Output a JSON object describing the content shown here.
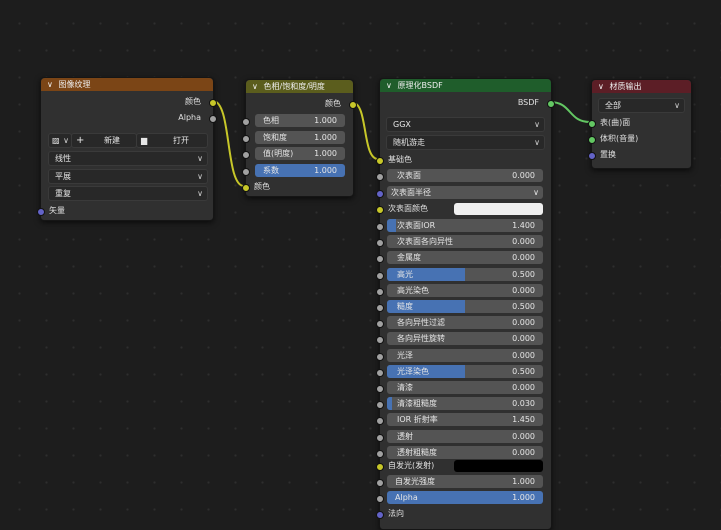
{
  "image_texture": {
    "title": "图像纹理",
    "outputs": [
      "颜色",
      "Alpha"
    ],
    "new_label": "新建",
    "open_label": "打开",
    "dropdowns": [
      "线性",
      "平展",
      "重复"
    ],
    "input_vector": "矢量"
  },
  "hsv": {
    "title": "色相/饱和度/明度",
    "output": "颜色",
    "fields": [
      {
        "label": "色相",
        "value": "1.000"
      },
      {
        "label": "饱和度",
        "value": "1.000"
      },
      {
        "label": "值(明度)",
        "value": "1.000"
      },
      {
        "label": "系数",
        "value": "1.000"
      }
    ],
    "input_color": "颜色"
  },
  "bsdf": {
    "title": "原理化BSDF",
    "output": "BSDF",
    "distribution": "GGX",
    "subsurface_method": "随机游走",
    "base_color": "基础色",
    "subsurface": {
      "label": "次表面",
      "value": "0.000"
    },
    "subsurface_radius": "次表面半径",
    "subsurface_color": "次表面颜色",
    "fields": [
      {
        "label": "次表面IOR",
        "value": "1.400",
        "fill": 0.06
      },
      {
        "label": "次表面各向异性",
        "value": "0.000",
        "fill": 0
      },
      {
        "label": "金属度",
        "value": "0.000",
        "fill": 0
      },
      {
        "label": "高光",
        "value": "0.500",
        "fill": 0.5
      },
      {
        "label": "高光染色",
        "value": "0.000",
        "fill": 0
      },
      {
        "label": "糙度",
        "value": "0.500",
        "fill": 0.5
      },
      {
        "label": "各向异性过滤",
        "value": "0.000",
        "fill": 0
      },
      {
        "label": "各向异性旋转",
        "value": "0.000",
        "fill": 0
      },
      {
        "label": "光泽",
        "value": "0.000",
        "fill": 0
      },
      {
        "label": "光泽染色",
        "value": "0.500",
        "fill": 0.5
      },
      {
        "label": "清漆",
        "value": "0.000",
        "fill": 0
      },
      {
        "label": "清漆粗糙度",
        "value": "0.030",
        "fill": 0.03
      },
      {
        "label": "IOR 折射率",
        "value": "1.450",
        "fill": 0
      },
      {
        "label": "透射",
        "value": "0.000",
        "fill": 0
      },
      {
        "label": "透射粗糙度",
        "value": "0.000",
        "fill": 0
      }
    ],
    "emission": "自发光(发射)",
    "emission_strength": {
      "label": "自发光强度",
      "value": "1.000"
    },
    "alpha": {
      "label": "Alpha",
      "value": "1.000"
    },
    "normal": "法向",
    "colors": {
      "subsurface_color": "#f0f0f0",
      "emission_color": "#000000"
    }
  },
  "material_output": {
    "title": "材质输出",
    "target": "全部",
    "inputs": [
      "表(曲)面",
      "体积(音量)",
      "置换"
    ]
  },
  "colors": {
    "accent": "#4772b3",
    "canvas": "#1d1d1d",
    "node_body": "#303030"
  }
}
